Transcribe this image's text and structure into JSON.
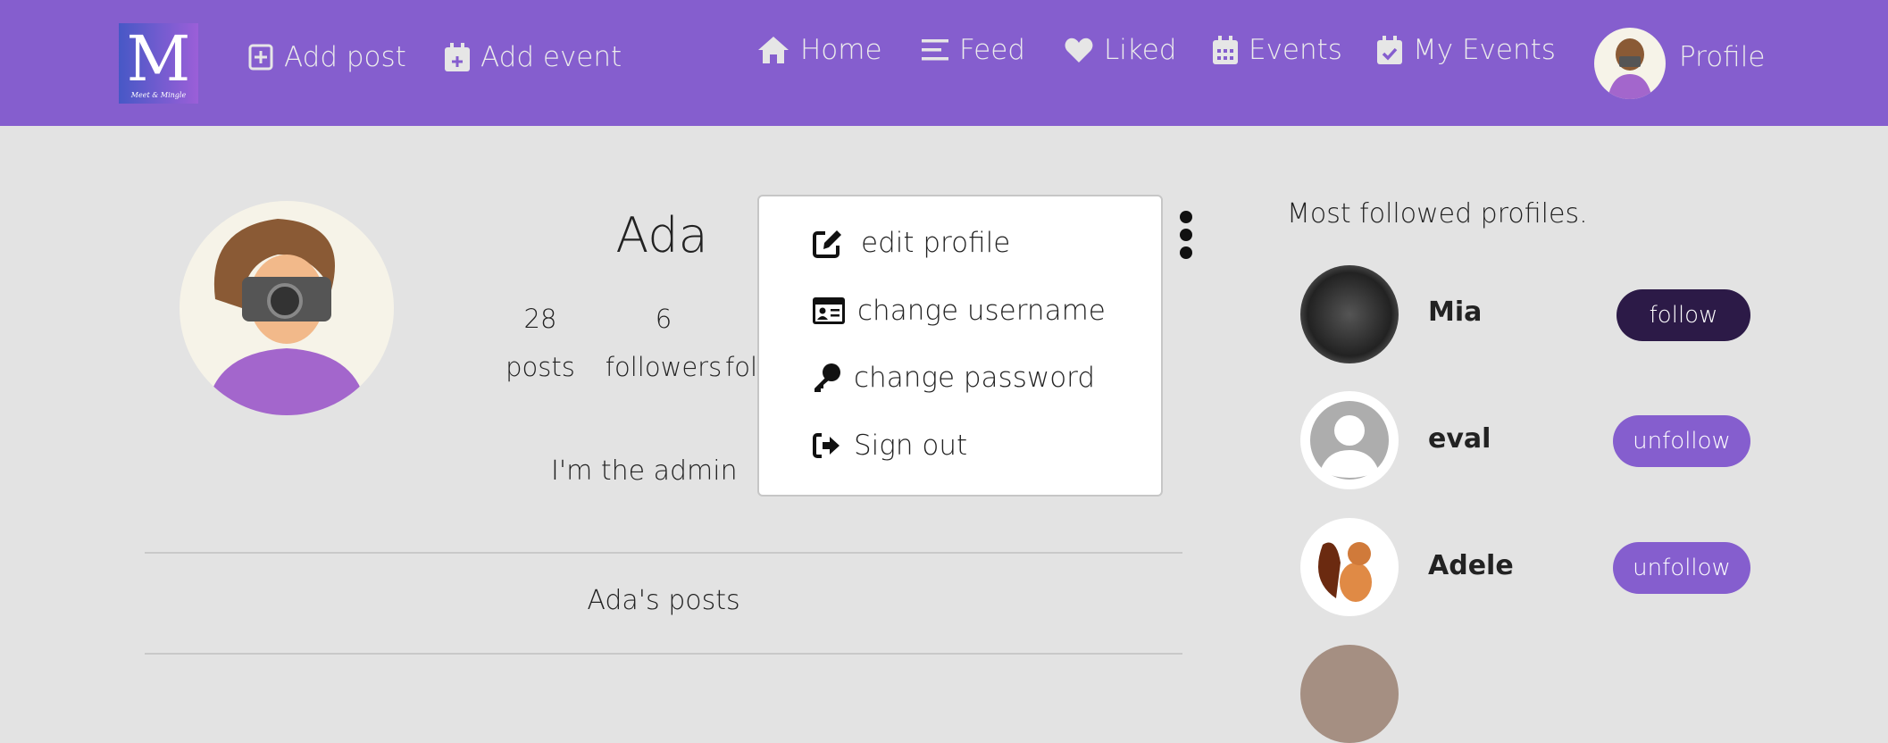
{
  "nav": {
    "logo_text": "M",
    "logo_tagline": "Meet & Mingle",
    "add_post": "Add post",
    "add_event": "Add event",
    "home": "Home",
    "feed": "Feed",
    "liked": "Liked",
    "events": "Events",
    "my_events": "My Events",
    "profile": "Profile"
  },
  "profile": {
    "name": "Ada",
    "posts_count": "28",
    "posts_label": "posts",
    "followers_count": "6",
    "followers_label": "followers",
    "following_label": "fol",
    "bio": "I'm the admin",
    "posts_heading": "Ada's posts"
  },
  "menu": {
    "items": [
      {
        "label": "edit profile",
        "icon": "edit-icon"
      },
      {
        "label": "change username",
        "icon": "id-card-icon"
      },
      {
        "label": "change password",
        "icon": "key-icon"
      },
      {
        "label": "Sign out",
        "icon": "sign-out-icon"
      }
    ]
  },
  "sidebar": {
    "title": "Most followed profiles.",
    "profiles": [
      {
        "name": "Mia",
        "button": "follow"
      },
      {
        "name": "eval",
        "button": "unfollow"
      },
      {
        "name": "Adele",
        "button": "unfollow"
      }
    ]
  },
  "colors": {
    "nav": "#855ece",
    "follow": "#2c1a47",
    "unfollow": "#855ece",
    "background": "#e3e3e3"
  }
}
